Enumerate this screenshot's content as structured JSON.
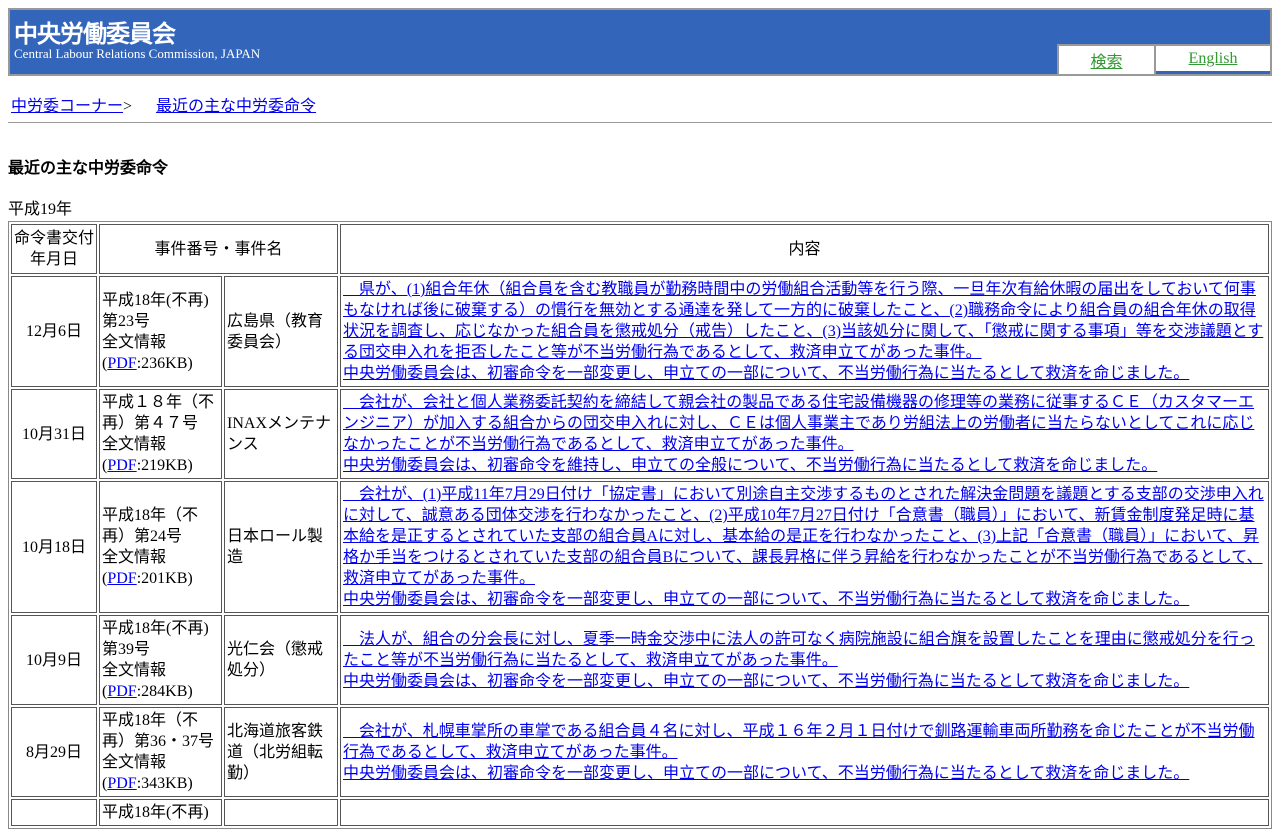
{
  "header": {
    "title": "中央労働委員会",
    "subtitle": "Central Labour Relations Commission, JAPAN",
    "search_label": "検索",
    "english_label": "English"
  },
  "breadcrumb": {
    "home": "中労委コーナー",
    "separator": ">",
    "current": "最近の主な中労委命令"
  },
  "page_title": "最近の主な中労委命令",
  "year": "平成19年",
  "table": {
    "headers": {
      "date": "命令書交付年月日",
      "case": "事件番号・事件名",
      "content": "内容"
    },
    "rows": [
      {
        "date": "12月6日",
        "case_no": "平成18年(不再)第23号",
        "full_text": "全文情報",
        "pdf_label": "PDF",
        "pdf_size": ":236KB)",
        "name": "広島県（教育委員会）",
        "desc": "　県が、(1)組合年休（組合員を含む教職員が勤務時間中の労働組合活動等を行う際、一旦年次有給休暇の届出をしておいて何事もなければ後に破棄する）の慣行を無効とする通達を発して一方的に破棄したこと、(2)職務命令により組合員の組合年休の取得状況を調査し、応じなかった組合員を懲戒処分（戒告）したこと、(3)当該処分に関して、「懲戒に関する事項」等を交渉議題とする団交申入れを拒否したこと等が不当労働行為であるとして、救済申立てがあった事件。",
        "decision": "中央労働委員会は、初審命令を一部変更し、申立ての一部について、不当労働行為に当たるとして救済を命じました。"
      },
      {
        "date": "10月31日",
        "case_no": "平成１８年（不再）第４７号",
        "full_text": "全文情報",
        "pdf_label": "PDF",
        "pdf_size": ":219KB)",
        "name": "INAXメンテナンス",
        "desc": "　会社が、会社と個人業務委託契約を締結して親会社の製品である住宅設備機器の修理等の業務に従事するＣＥ（カスタマーエンジニア）が加入する組合からの団交申入れに対し、ＣＥは個人事業主であり労組法上の労働者に当たらないとしてこれに応じなかったことが不当労働行為であるとして、救済申立てがあった事件。",
        "decision": "中央労働委員会は、初審命令を維持し、申立ての全般について、不当労働行為に当たるとして救済を命じました。"
      },
      {
        "date": "10月18日",
        "case_no": "平成18年（不再）第24号",
        "full_text": "全文情報",
        "pdf_label": "PDF",
        "pdf_size": ":201KB)",
        "name": "日本ロール製造",
        "desc": "　会社が、(1)平成11年7月29日付け「協定書」において別途自主交渉するものとされた解決金問題を議題とする支部の交渉申入れに対して、誠意ある団体交渉を行わなかったこと、(2)平成10年7月27日付け「合意書（職員）」において、新賃金制度発足時に基本給を是正するとされていた支部の組合員Aに対し、基本給の是正を行わなかったこと、(3)上記「合意書（職員）」において、昇格か手当をつけるとされていた支部の組合員Bについて、課長昇格に伴う昇給を行わなかったことが不当労働行為であるとして、救済申立てがあった事件。",
        "decision": "中央労働委員会は、初審命令を一部変更し、申立ての一部について、不当労働行為に当たるとして救済を命じました。"
      },
      {
        "date": "10月9日",
        "case_no": "平成18年(不再)第39号",
        "full_text": "全文情報",
        "pdf_label": "PDF",
        "pdf_size": ":284KB)",
        "name": "光仁会（懲戒処分）",
        "desc": "　法人が、組合の分会長に対し、夏季一時金交渉中に法人の許可なく病院施設に組合旗を設置したことを理由に懲戒処分を行ったこと等が不当労働行為に当たるとして、救済申立てがあった事件。",
        "decision": "中央労働委員会は、初審命令を一部変更し、申立ての一部について、不当労働行為に当たるとして救済を命じました。"
      },
      {
        "date": "8月29日",
        "case_no": "平成18年（不再）第36・37号",
        "full_text": "全文情報",
        "pdf_label": "PDF",
        "pdf_size": ":343KB)",
        "name": "北海道旅客鉄道（北労組転勤）",
        "desc": "　会社が、札幌車掌所の車掌である組合員４名に対し、平成１６年２月１日付けで釧路運輸車両所勤務を命じたことが不当労働行為であるとして、救済申立てがあった事件。",
        "decision": "中央労働委員会は、初審命令を一部変更し、申立ての一部について、不当労働行為に当たるとして救済を命じました。"
      },
      {
        "case_no": "平成18年(不再)"
      }
    ]
  }
}
